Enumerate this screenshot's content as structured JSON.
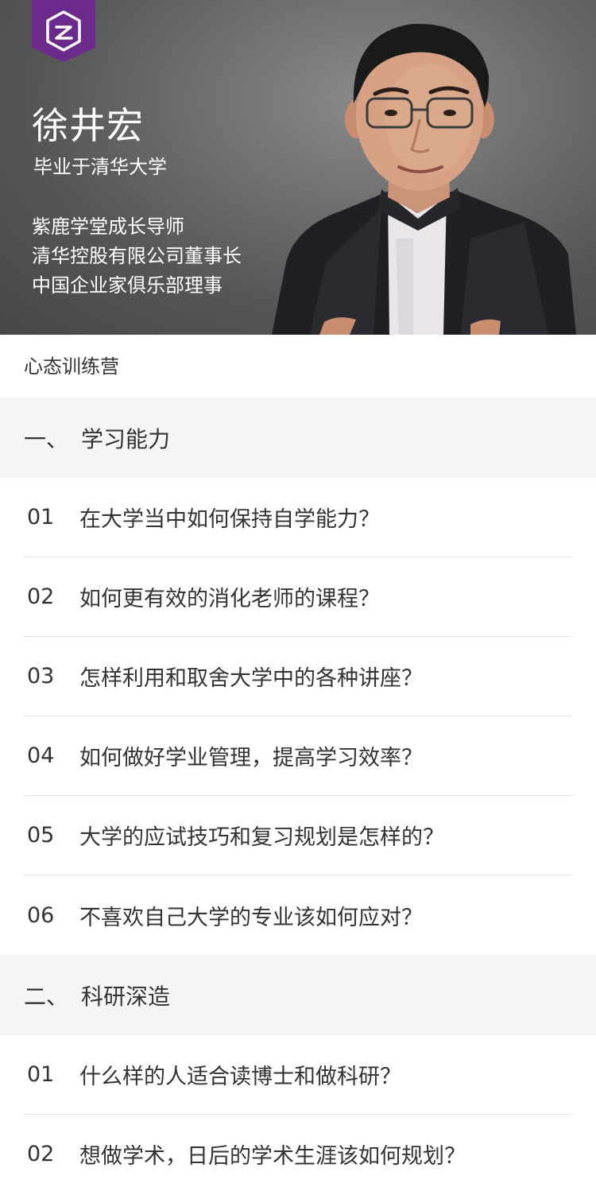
{
  "hero": {
    "name": "徐井宏",
    "graduation": "毕业于清华大学",
    "roles": [
      "紫鹿学堂成长导师",
      "清华控股有限公司董事长",
      "中国企业家俱乐部理事"
    ]
  },
  "course_title": "心态训练营",
  "sections": [
    {
      "number": "一、",
      "title": "学习能力",
      "lessons": [
        {
          "num": "01",
          "title": "在大学当中如何保持自学能力？"
        },
        {
          "num": "02",
          "title": "如何更有效的消化老师的课程？"
        },
        {
          "num": "03",
          "title": "怎样利用和取舍大学中的各种讲座？"
        },
        {
          "num": "04",
          "title": "如何做好学业管理，提高学习效率？"
        },
        {
          "num": "05",
          "title": "大学的应试技巧和复习规划是怎样的？"
        },
        {
          "num": "06",
          "title": "不喜欢自己大学的专业该如何应对？"
        }
      ]
    },
    {
      "number": "二、",
      "title": "科研深造",
      "lessons": [
        {
          "num": "01",
          "title": "什么样的人适合读博士和做科研？"
        },
        {
          "num": "02",
          "title": "想做学术，日后的学术生涯该如何规划？"
        }
      ]
    }
  ],
  "colors": {
    "brand_purple": "#6b2a8c",
    "section_bg": "#f5f5f5",
    "divider": "#e3e3e3",
    "text": "#333333"
  }
}
